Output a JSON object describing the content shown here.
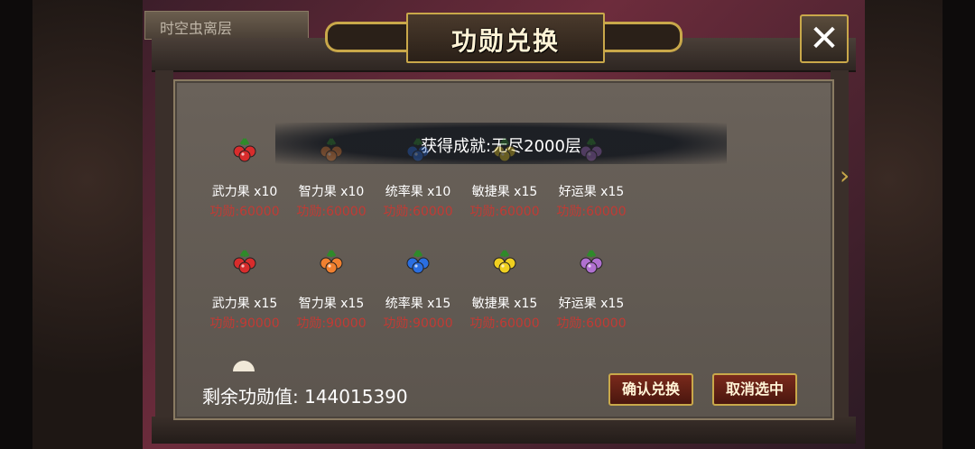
{
  "background_label": "时空虫离层",
  "dialog": {
    "title": "功勋兑换",
    "close_label": "✕"
  },
  "banner": {
    "text": "获得成就:无尽2000层"
  },
  "rows": [
    [
      {
        "name": "武力果 x10",
        "cost": "功勋:60000",
        "color": "#d82c2c"
      },
      {
        "name": "智力果 x10",
        "cost": "功勋:60000",
        "color": "#f08030"
      },
      {
        "name": "统率果 x10",
        "cost": "功勋:60000",
        "color": "#2a6ee0"
      },
      {
        "name": "敏捷果 x15",
        "cost": "功勋:60000",
        "color": "#f0d020"
      },
      {
        "name": "好运果 x15",
        "cost": "功勋:60000",
        "color": "#b070d0"
      }
    ],
    [
      {
        "name": "武力果 x15",
        "cost": "功勋:90000",
        "color": "#d82c2c"
      },
      {
        "name": "智力果 x15",
        "cost": "功勋:90000",
        "color": "#f08030"
      },
      {
        "name": "统率果 x15",
        "cost": "功勋:90000",
        "color": "#2a6ee0"
      },
      {
        "name": "敏捷果 x15",
        "cost": "功勋:60000",
        "color": "#f0d020"
      },
      {
        "name": "好运果 x15",
        "cost": "功勋:60000",
        "color": "#b070d0"
      }
    ]
  ],
  "footer": {
    "remaining_label": "剩余功勋值:",
    "remaining_value": "144015390",
    "confirm_label": "确认兑换",
    "cancel_label": "取消选中"
  }
}
